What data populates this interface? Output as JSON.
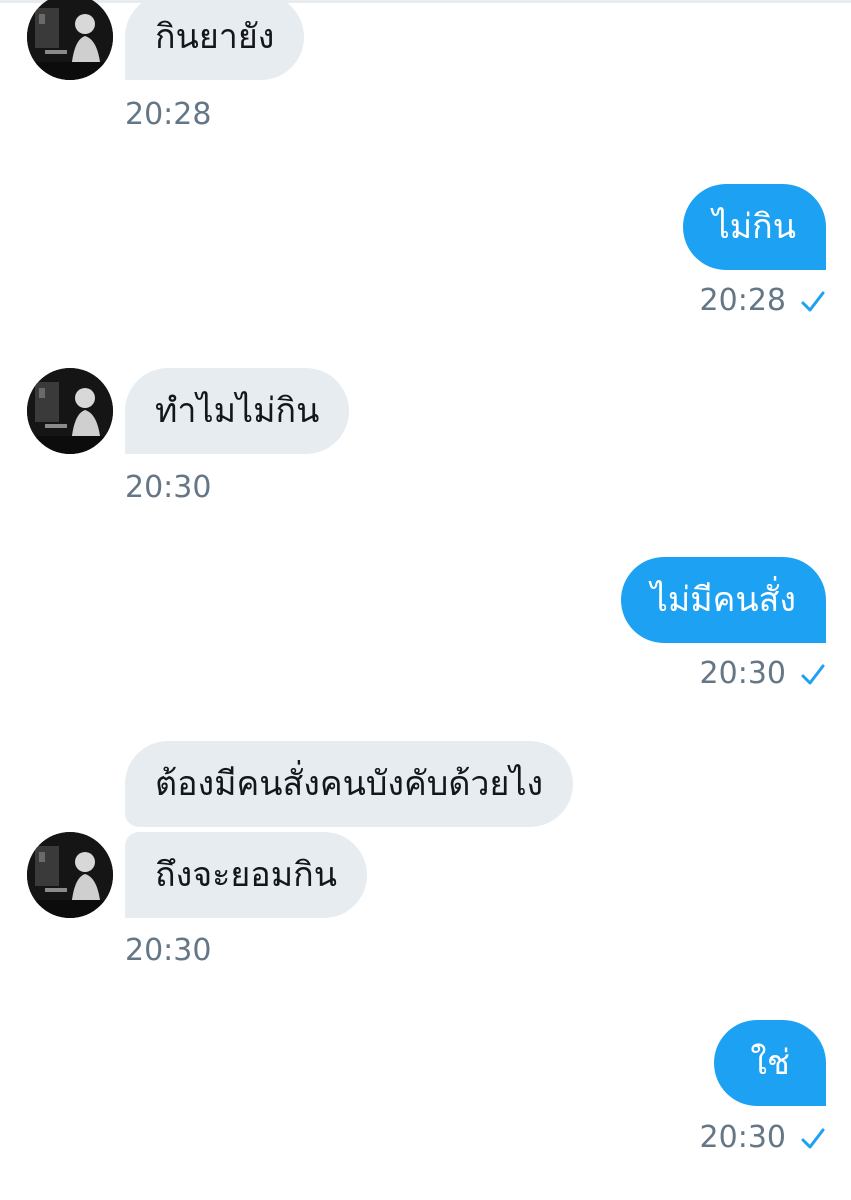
{
  "conversation": {
    "colors": {
      "incoming_bubble": "#e6ecf0",
      "outgoing_bubble": "#1da1f2",
      "timestamp": "#657786",
      "read_check": "#1da1f2"
    },
    "messages": [
      {
        "direction": "incoming",
        "text": "กินยายัง",
        "time": "20:28"
      },
      {
        "direction": "outgoing",
        "text": "ไม่กิน",
        "time": "20:28",
        "status_icon": "check-icon"
      },
      {
        "direction": "incoming",
        "text": "ทำไมไม่กิน",
        "time": "20:30"
      },
      {
        "direction": "outgoing",
        "text": "ไม่มีคนสั่ง",
        "time": "20:30",
        "status_icon": "check-icon"
      },
      {
        "direction": "incoming",
        "text": "ต้องมีคนสั่งคนบังคับด้วยไง"
      },
      {
        "direction": "incoming",
        "text": "ถึงจะยอมกิน",
        "time": "20:30"
      },
      {
        "direction": "outgoing",
        "text": "ใช่",
        "time": "20:30",
        "status_icon": "check-icon"
      }
    ]
  }
}
